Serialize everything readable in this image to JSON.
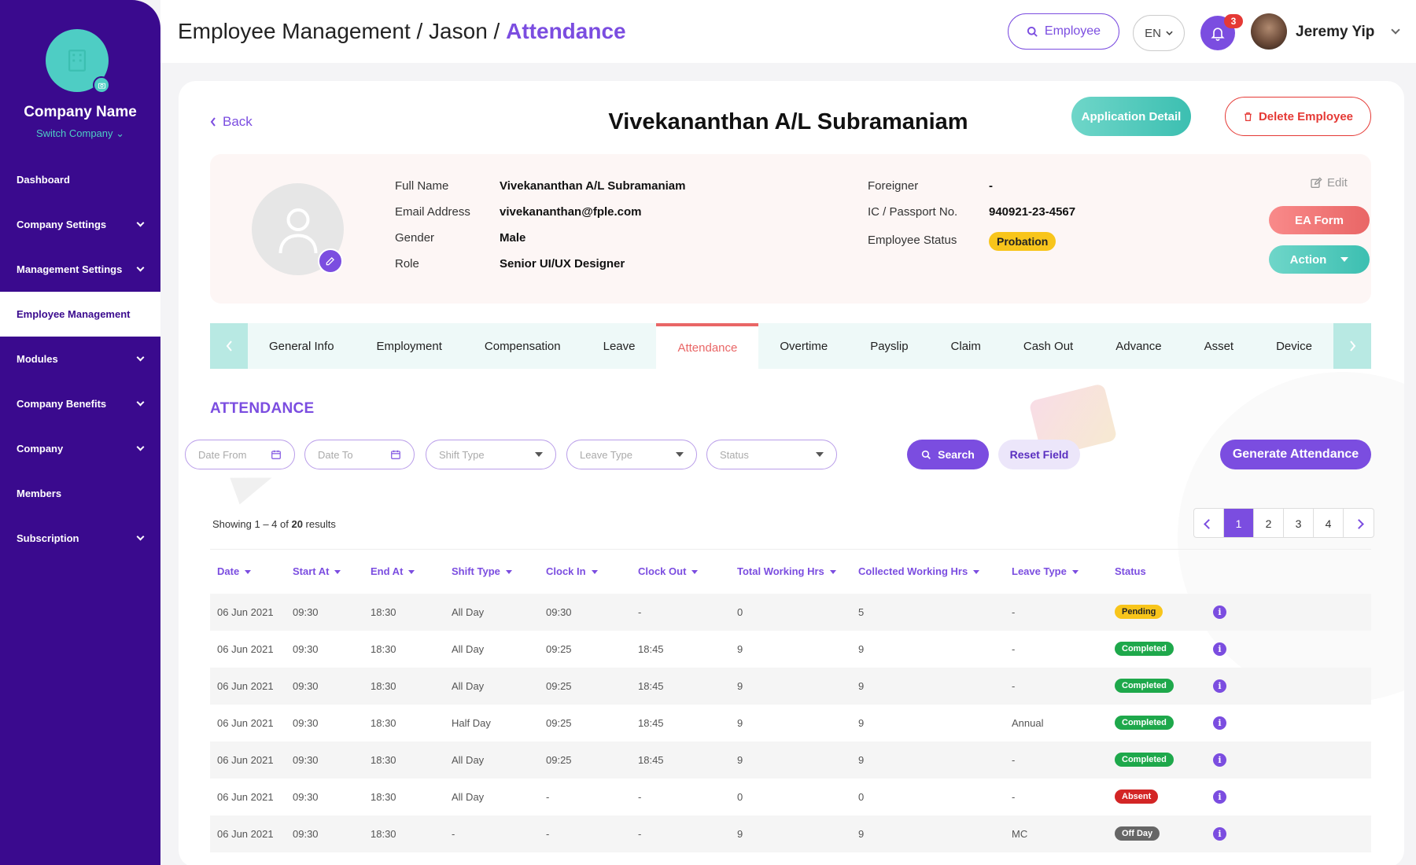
{
  "sidebar": {
    "company_name": "Company Name",
    "switch_company": "Switch Company ⌄",
    "items": [
      {
        "label": "Dashboard",
        "has_chevron": false,
        "active": false
      },
      {
        "label": "Company Settings",
        "has_chevron": true,
        "active": false
      },
      {
        "label": "Management Settings",
        "has_chevron": true,
        "active": false
      },
      {
        "label": "Employee Management",
        "has_chevron": false,
        "active": true
      },
      {
        "label": "Modules",
        "has_chevron": true,
        "active": false
      },
      {
        "label": "Company Benefits",
        "has_chevron": true,
        "active": false
      },
      {
        "label": "Company",
        "has_chevron": true,
        "active": false
      },
      {
        "label": "Members",
        "has_chevron": false,
        "active": false
      },
      {
        "label": "Subscription",
        "has_chevron": true,
        "active": false
      }
    ]
  },
  "header": {
    "breadcrumb_prefix": "Employee Management / Jason / ",
    "breadcrumb_current": "Attendance",
    "employee_button": "Employee",
    "language": "EN",
    "notification_count": "3",
    "user_name": "Jeremy Yip"
  },
  "employee": {
    "back_label": "Back",
    "name": "Vivekananthan A/L Subramaniam",
    "application_detail": "Application Detail",
    "delete_employee": "Delete Employee",
    "fields": {
      "full_name_label": "Full Name",
      "full_name": "Vivekananthan A/L Subramaniam",
      "email_label": "Email Address",
      "email": "vivekananthan@fple.com",
      "gender_label": "Gender",
      "gender": "Male",
      "role_label": "Role",
      "role": "Senior UI/UX Designer",
      "foreigner_label": "Foreigner",
      "foreigner": "-",
      "ic_label": "IC / Passport No.",
      "ic": "940921-23-4567",
      "status_label": "Employee Status",
      "status": "Probation"
    },
    "edit_label": "Edit",
    "ea_form": "EA Form",
    "action": "Action"
  },
  "tabs": [
    "General Info",
    "Employment",
    "Compensation",
    "Leave",
    "Attendance",
    "Overtime",
    "Payslip",
    "Claim",
    "Cash Out",
    "Advance",
    "Asset",
    "Device"
  ],
  "active_tab": "Attendance",
  "attendance": {
    "title": "ATTENDANCE",
    "filters": {
      "date_from": "Date From",
      "date_to": "Date To",
      "shift_type": "Shift Type",
      "leave_type": "Leave Type",
      "status": "Status"
    },
    "search": "Search",
    "reset": "Reset Field",
    "generate": "Generate Attendance",
    "showing_prefix": "Showing 1 – 4 of ",
    "showing_total": "20",
    "showing_suffix": " results",
    "pages": [
      "1",
      "2",
      "3",
      "4"
    ],
    "current_page": "1",
    "columns": [
      "Date",
      "Start At",
      "End At",
      "Shift Type",
      "Clock In",
      "Clock Out",
      "Total Working Hrs",
      "Collected Working Hrs",
      "Leave Type",
      "Status"
    ],
    "rows": [
      {
        "date": "06 Jun 2021",
        "start": "09:30",
        "end": "18:30",
        "shift": "All Day",
        "clock_in": "09:30",
        "clock_out": "-",
        "total": "0",
        "collected": "5",
        "leave": "-",
        "status": "Pending",
        "status_key": "pending"
      },
      {
        "date": "06 Jun 2021",
        "start": "09:30",
        "end": "18:30",
        "shift": "All Day",
        "clock_in": "09:25",
        "clock_out": "18:45",
        "total": "9",
        "collected": "9",
        "leave": "-",
        "status": "Completed",
        "status_key": "completed"
      },
      {
        "date": "06 Jun 2021",
        "start": "09:30",
        "end": "18:30",
        "shift": "All Day",
        "clock_in": "09:25",
        "clock_out": "18:45",
        "total": "9",
        "collected": "9",
        "leave": "-",
        "status": "Completed",
        "status_key": "completed"
      },
      {
        "date": "06 Jun 2021",
        "start": "09:30",
        "end": "18:30",
        "shift": "Half Day",
        "clock_in": "09:25",
        "clock_out": "18:45",
        "total": "9",
        "collected": "9",
        "leave": "Annual",
        "status": "Completed",
        "status_key": "completed"
      },
      {
        "date": "06 Jun 2021",
        "start": "09:30",
        "end": "18:30",
        "shift": "All Day",
        "clock_in": "09:25",
        "clock_out": "18:45",
        "total": "9",
        "collected": "9",
        "leave": "-",
        "status": "Completed",
        "status_key": "completed"
      },
      {
        "date": "06 Jun 2021",
        "start": "09:30",
        "end": "18:30",
        "shift": "All Day",
        "clock_in": "-",
        "clock_out": "-",
        "total": "0",
        "collected": "0",
        "leave": "-",
        "status": "Absent",
        "status_key": "absent"
      },
      {
        "date": "06 Jun 2021",
        "start": "09:30",
        "end": "18:30",
        "shift": "-",
        "clock_in": "-",
        "clock_out": "-",
        "total": "9",
        "collected": "9",
        "leave": "MC",
        "status": "Off Day",
        "status_key": "offday"
      }
    ]
  },
  "colors": {
    "primary": "#7b4de0",
    "sidebar": "#3a0a8e",
    "teal": "#4ecdc4",
    "danger": "#e53935",
    "warning": "#f8c51b",
    "success": "#1ea84b"
  }
}
